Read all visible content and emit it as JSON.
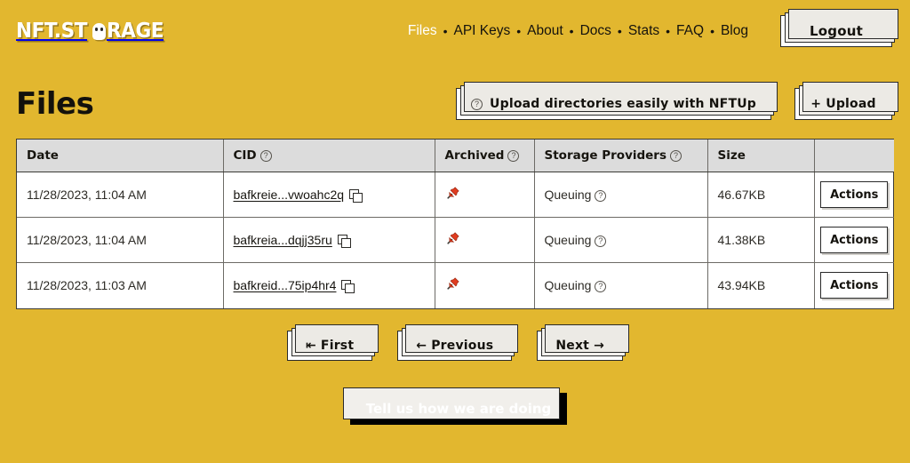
{
  "brand": {
    "name_part1": "NFT.ST",
    "name_part2": "RAGE",
    "logo_icon": "ghost-mascot-icon"
  },
  "nav": {
    "separator": "•",
    "items": [
      {
        "label": "Files",
        "active": true
      },
      {
        "label": "API Keys",
        "active": false
      },
      {
        "label": "About",
        "active": false
      },
      {
        "label": "Docs",
        "active": false
      },
      {
        "label": "Stats",
        "active": false
      },
      {
        "label": "FAQ",
        "active": false
      },
      {
        "label": "Blog",
        "active": false
      }
    ],
    "logout_label": "Logout"
  },
  "page": {
    "title": "Files",
    "nftup_label": "Upload directories easily with NFTUp",
    "nftup_icon": "help-circle-icon",
    "upload_label": "+ Upload"
  },
  "table": {
    "columns": [
      {
        "key": "date",
        "label": "Date",
        "help": false
      },
      {
        "key": "cid",
        "label": "CID",
        "help": true
      },
      {
        "key": "archived",
        "label": "Archived",
        "help": true
      },
      {
        "key": "storage",
        "label": "Storage Providers",
        "help": true
      },
      {
        "key": "size",
        "label": "Size",
        "help": false
      },
      {
        "key": "actions",
        "label": "",
        "help": false
      }
    ],
    "help_glyph": "?",
    "copy_icon": "copy-icon",
    "pin_icon": "pushpin-icon",
    "actions_label": "Actions",
    "rows": [
      {
        "date": "11/28/2023, 11:04 AM",
        "cid": "bafkreie...vwoahc2q",
        "archived": "pinned",
        "storage": "Queuing",
        "size": "46.67KB",
        "actions": "Actions"
      },
      {
        "date": "11/28/2023, 11:04 AM",
        "cid": "bafkreia...dqjj35ru",
        "archived": "pinned",
        "storage": "Queuing",
        "size": "41.38KB",
        "actions": "Actions"
      },
      {
        "date": "11/28/2023, 11:03 AM",
        "cid": "bafkreid...75ip4hr4",
        "archived": "pinned",
        "storage": "Queuing",
        "size": "43.94KB",
        "actions": "Actions"
      }
    ]
  },
  "pagination": {
    "first_label": "⇤ First",
    "previous_label": "← Previous",
    "next_label": "Next →"
  },
  "feedback": {
    "label": "Tell us how we are doing"
  },
  "colors": {
    "background": "#e2b72f",
    "header_row": "#dcdcdc",
    "pin_red": "#e03c20",
    "text": "#14120d",
    "active_nav": "#ffffff"
  }
}
